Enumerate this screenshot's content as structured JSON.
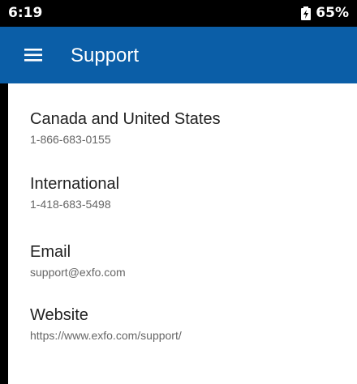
{
  "status_bar": {
    "time": "6:19",
    "battery": "65%",
    "battery_icon": "battery-charging-icon"
  },
  "app_bar": {
    "menu_icon": "hamburger-menu-icon",
    "title": "Support",
    "background_color": "#0b5ea7"
  },
  "contacts": [
    {
      "label": "Canada and United States",
      "value": "1-866-683-0155"
    },
    {
      "label": "International",
      "value": "1-418-683-5498"
    },
    {
      "label": "Email",
      "value": "support@exfo.com"
    },
    {
      "label": "Website",
      "value": "https://www.exfo.com/support/"
    }
  ]
}
